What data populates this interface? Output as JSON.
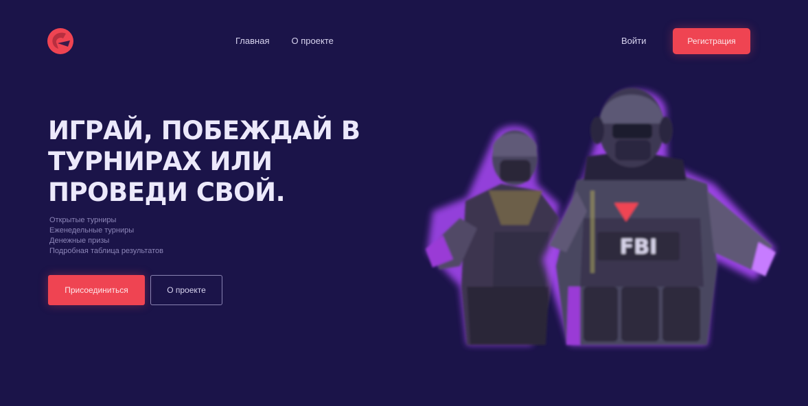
{
  "header": {
    "nav": [
      {
        "label": "Главная"
      },
      {
        "label": "О проекте"
      }
    ],
    "login_label": "Войти",
    "signup_label": "Регистрация"
  },
  "hero": {
    "title": "ИГРАЙ, ПОБЕЖДАЙ В ТУРНИРАХ ИЛИ ПРОВЕДИ СВОЙ.",
    "lines": [
      "Открытые турниры",
      "Еженедельные турниры",
      "Денежные призы",
      "Подробная таблица результатов"
    ],
    "primary_button": "Присоединиться",
    "secondary_button": "О проекте",
    "art_badge_text": "FBI"
  },
  "colors": {
    "background": "#1b1449",
    "accent": "#ef4452",
    "glow": "#b14cff"
  },
  "icons": {
    "logo": "brand-logo-icon"
  }
}
